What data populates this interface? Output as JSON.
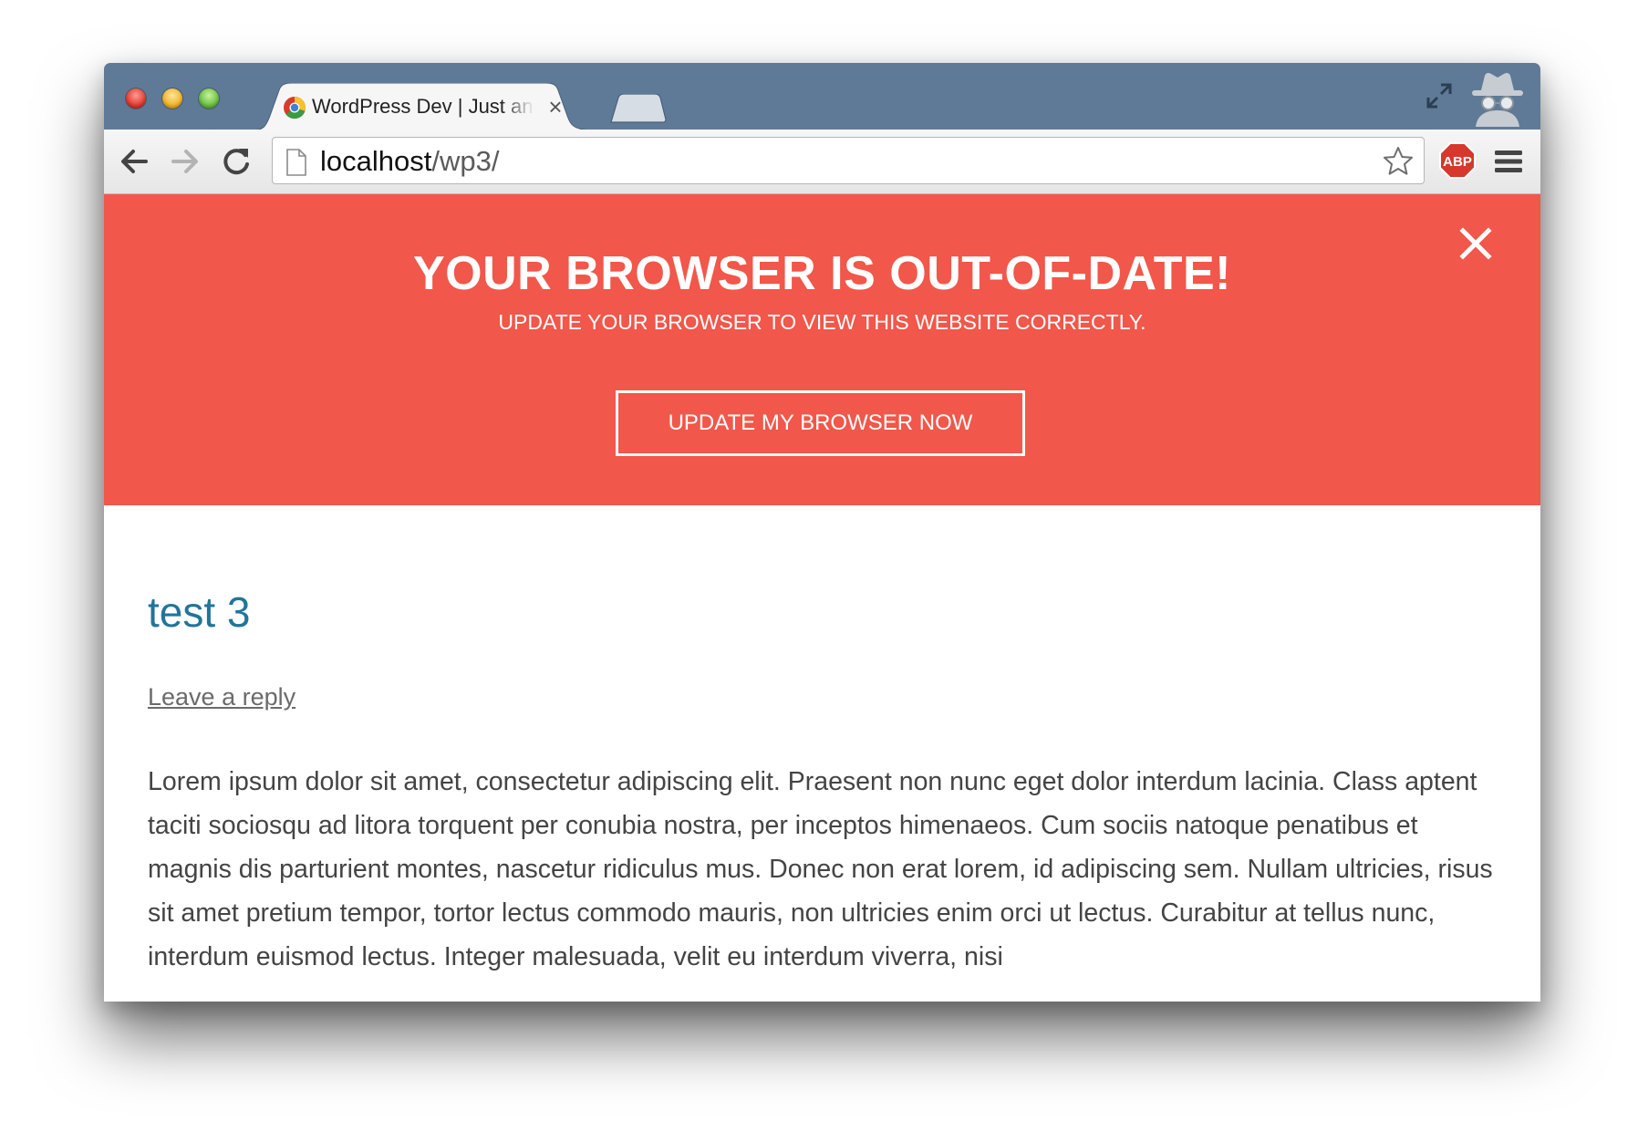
{
  "browser": {
    "tab": {
      "title": "WordPress Dev | Just another WordPress site",
      "close_glyph": "×",
      "favicon": "wordpress-chrome-favicon"
    },
    "address": {
      "host": "localhost",
      "path": "/wp3/"
    },
    "icons": {
      "back": "back-arrow-icon",
      "forward": "forward-arrow-icon",
      "reload": "reload-icon",
      "page": "page-icon",
      "star": "star-icon",
      "adblock": "adblock-plus-icon",
      "menu": "hamburger-menu-icon",
      "incognito": "incognito-icon",
      "fullscreen": "fullscreen-icon"
    },
    "adblock_label": "ABP"
  },
  "banner": {
    "title": "YOUR BROWSER IS OUT-OF-DATE!",
    "subtitle": "UPDATE YOUR BROWSER TO VIEW THIS WEBSITE CORRECTLY.",
    "button_label": "UPDATE MY BROWSER NOW",
    "background": "#f1574a"
  },
  "post": {
    "title": "test 3",
    "reply_link": "Leave a reply",
    "body": "Lorem ipsum dolor sit amet, consectetur adipiscing elit. Praesent non nunc eget dolor interdum lacinia. Class aptent taciti sociosqu ad litora torquent per conubia nostra, per inceptos himenaeos. Cum sociis natoque penatibus et magnis dis parturient montes, nascetur ridiculus mus. Donec non erat lorem, id adipiscing sem. Nullam ultricies, risus sit amet pretium tempor, tortor lectus commodo mauris, non ultricies enim orci ut lectus. Curabitur at tellus nunc, interdum euismod lectus. Integer malesuada, velit eu interdum viverra, nisi",
    "title_color": "#21759b"
  }
}
